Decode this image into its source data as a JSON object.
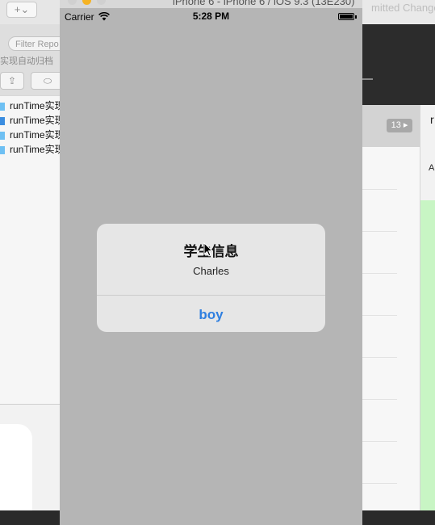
{
  "xcode": {
    "add_button_label": "+⌄",
    "filter_placeholder": "Filter Repo",
    "project_title": "实现自动归档",
    "right_title": "mitted Change",
    "file_list": [
      {
        "label": "runTime实现"
      },
      {
        "label": "runTime实现"
      },
      {
        "label": "runTime实现"
      },
      {
        "label": "runTime实现"
      }
    ],
    "line_count_badge": "13 ▸",
    "inspector_r": "r",
    "inspector_a": "A"
  },
  "simulator": {
    "window_title": "iPhone 6 - iPhone 6 / iOS 9.3 (13E230)",
    "status_bar": {
      "carrier": "Carrier",
      "time": "5:28 PM",
      "wifi_icon": "wifi-icon",
      "battery_icon": "battery-icon"
    },
    "alert": {
      "title": "学生信息",
      "message": "Charles",
      "button_label": "boy"
    }
  },
  "colors": {
    "alert_button": "#2f7fe0",
    "screen_dim": "#b5b5b5",
    "alert_bg": "#e6e6e6",
    "file_icon": "#6ec0f3"
  }
}
